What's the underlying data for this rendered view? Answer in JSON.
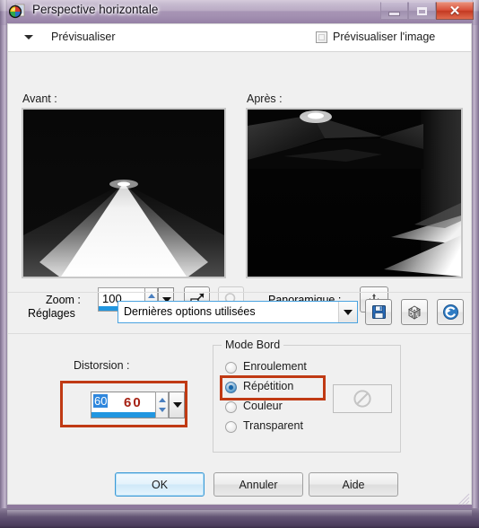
{
  "window": {
    "title": "Perspective horizontale",
    "icon": "app-sphere-icon",
    "controls": {
      "minimize": "—",
      "maximize": "☐",
      "close": "✕"
    }
  },
  "preview_panel": {
    "header_label": "Prévisualiser",
    "collapse_icon": "chevron-down-icon",
    "preview_image_checkbox": {
      "label": "Prévisualiser l'image",
      "checked": false
    },
    "before_caption": "Avant :",
    "after_caption": "Après :"
  },
  "zoom_row": {
    "label": "Zoom :",
    "value": "100",
    "fit_button_icon": "fit-to-window-icon",
    "magnify_button_icon": "magnifier-icon",
    "magnify_disabled": true,
    "panoramique_label": "Panoramique :",
    "panoramique_icon": "move-cross-icon"
  },
  "reglages_row": {
    "label": "Réglages",
    "selected_option": "Dernières options utilisées",
    "options": [
      "Dernières options utilisées"
    ],
    "save_icon": "floppy-save-icon",
    "random_icon": "dice-randomize-icon",
    "reset_icon": "reset-circular-arrow-icon"
  },
  "settings": {
    "distorsion": {
      "label": "Distorsion :",
      "value": "60",
      "annotation_value": "60",
      "highlight_color": "#c03a14"
    },
    "mode_bord": {
      "title": "Mode Bord",
      "selected": "Répétition",
      "highlight_color": "#c03a14",
      "options": [
        {
          "label": "Enroulement",
          "checked": false
        },
        {
          "label": "Répétition",
          "checked": true
        },
        {
          "label": "Couleur",
          "checked": false
        },
        {
          "label": "Transparent",
          "checked": false
        }
      ],
      "color_swatch": {
        "enabled": false,
        "icon": "no-entry-icon"
      }
    }
  },
  "buttons": {
    "ok": "OK",
    "cancel": "Annuler",
    "help": "Aide"
  },
  "colors": {
    "accent_blue": "#2196e0",
    "highlight_red": "#c03a14",
    "annotation_red": "#a62214",
    "titlebar_purple": "#a08ead",
    "close_red": "#d9503a"
  }
}
